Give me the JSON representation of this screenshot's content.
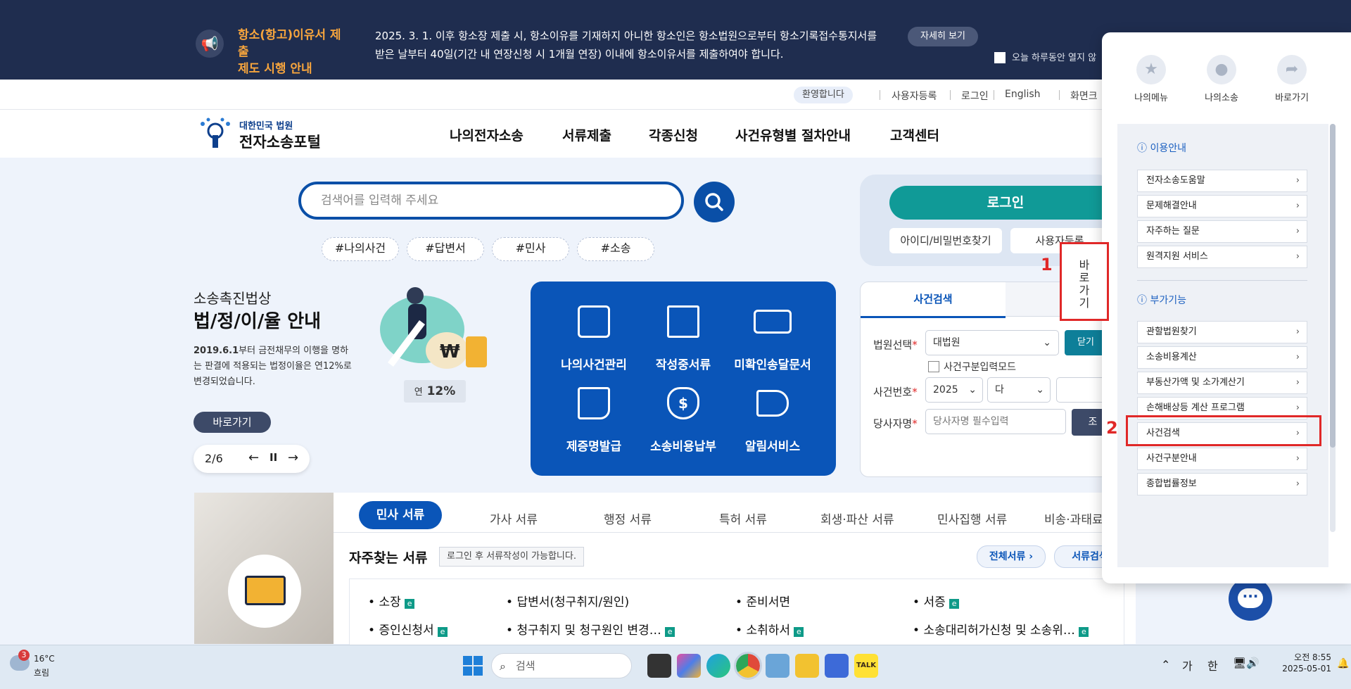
{
  "notice": {
    "title_line1": "항소(항고)이유서 제출",
    "title_line2": "제도 시행 안내",
    "message_line1": "2025. 3. 1. 이후 항소장 제출 시, 항소이유를 기재하지 아니한 항소인은 항소법원으로부터 항소기록접수통지서를",
    "message_line2": "받은 날부터 40일(기간 내 연장신청 시 1개월 연장) 이내에 항소이유서를 제출하여야 합니다.",
    "more_label": "자세히 보기",
    "hide_today_label": "오늘 하루동안 열지 않"
  },
  "util": {
    "welcome": "환영합니다",
    "links": [
      "사용자등록",
      "로그인",
      "English",
      "화면크"
    ]
  },
  "header": {
    "logo_line1": "대한민국 법원",
    "logo_line2": "전자소송포털",
    "nav": [
      "나의전자소송",
      "서류제출",
      "각종신청",
      "사건유형별 절차안내",
      "고객센터"
    ]
  },
  "search": {
    "placeholder": "검색어를 입력해 주세요",
    "tags": [
      "#나의사건",
      "#답변서",
      "#민사",
      "#소송"
    ]
  },
  "login": {
    "login_label": "로그인",
    "find_label": "아이디/비밀번호찾기",
    "register_label": "사용자등록"
  },
  "promo": {
    "line1": "소송촉진법상",
    "line2": "법/정/이/율 안내",
    "desc_bold": "2019.6.1",
    "desc": "부터 금전채무의 이행을 명하는 판결에 적용되는 법정이율은 연12%로 변경되었습니다.",
    "rate_prefix": "연",
    "rate_value": "12%",
    "go_label": "바로가기",
    "pager": "2/6"
  },
  "tiles": [
    {
      "label": "나의사건관리",
      "icon": "book-icon"
    },
    {
      "label": "작성중서류",
      "icon": "notebook-icon"
    },
    {
      "label": "미확인송달문서",
      "icon": "laptop-icon"
    },
    {
      "label": "제증명발급",
      "icon": "certificate-icon"
    },
    {
      "label": "소송비용납부",
      "icon": "money-bag-icon"
    },
    {
      "label": "알림서비스",
      "icon": "megaphone-icon"
    }
  ],
  "case_search": {
    "tab": "사건검색",
    "court_label": "법원선택",
    "court_value": "대법원",
    "close_label": "닫기",
    "mode_label": "사건구분입력모드",
    "number_label": "사건번호",
    "year_value": "2025",
    "type_value": "다",
    "party_label": "당사자명",
    "party_placeholder": "당사자명 필수입력",
    "search_label": "조"
  },
  "docs": {
    "tabs": [
      "민사 서류",
      "가사 서류",
      "행정 서류",
      "특허 서류",
      "회생·파산 서류",
      "민사집행 서류",
      "비송·과태료"
    ],
    "frequent_title": "자주찾는 서류",
    "frequent_note": "로그인 후 서류작성이 가능합니다.",
    "all_label": "전체서류",
    "search_label": "서류검색",
    "items": [
      "소장",
      "답변서(청구취지/원인)",
      "준비서면",
      "서증",
      "증인신청서",
      "청구취지 및 청구원인 변경…",
      "소취하서",
      "소송대리허가신청 및 소송위…"
    ],
    "e_badge": "e"
  },
  "panel": {
    "quick": [
      "나의메뉴",
      "나의소송",
      "바로가기"
    ],
    "section1": "이용안내",
    "items1": [
      "전자소송도움말",
      "문제해결안내",
      "자주하는 질문",
      "원격지원 서비스"
    ],
    "section2": "부가기능",
    "items2": [
      "관할법원찾기",
      "소송비용계산",
      "부동산가액 및 소가계산기",
      "손해배상등 계산 프로그램",
      "사건검색",
      "사건구분안내",
      "종합법률정보"
    ],
    "side_tab": [
      "바",
      "로",
      "가",
      "기"
    ],
    "marker1": "1",
    "marker2": "2"
  },
  "taskbar": {
    "weather_badge": "3",
    "temp": "16°C",
    "weather": "흐림",
    "search_placeholder": "검색",
    "ime1": "가",
    "ime2": "한",
    "time": "오전 8:55",
    "date": "2025-05-01"
  }
}
